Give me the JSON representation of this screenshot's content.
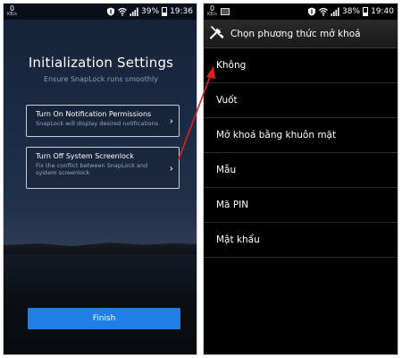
{
  "left_phone": {
    "status": {
      "kb_value": "0",
      "kb_unit": "KB/s",
      "battery_percent": "39%",
      "battery_level": 0.39,
      "time": "19:36"
    },
    "title": "Initialization Settings",
    "subtitle": "Ensure SnapLock runs smoothly",
    "cards": [
      {
        "title": "Turn On Notification Permissions",
        "description": "SnapLock will display desired notifications"
      },
      {
        "title": "Turn Off System Screenlock",
        "description": "Fix the conflict between SnapLock and system screenlock"
      }
    ],
    "finish_label": "Finish"
  },
  "right_phone": {
    "status": {
      "kb_value": "0",
      "kb_unit": "KB/s",
      "battery_percent": "38%",
      "battery_level": 0.38,
      "time": "19:40"
    },
    "header_title": "Chọn phương thức mở khoá",
    "items": [
      {
        "label": "Không"
      },
      {
        "label": "Vuốt"
      },
      {
        "label": "Mở khoá bằng khuôn mặt"
      },
      {
        "label": "Mẫu"
      },
      {
        "label": "Mã PIN"
      },
      {
        "label": "Mật khẩu"
      }
    ]
  },
  "colors": {
    "accent_blue": "#1f7fe6",
    "arrow_red": "#e0211b"
  }
}
